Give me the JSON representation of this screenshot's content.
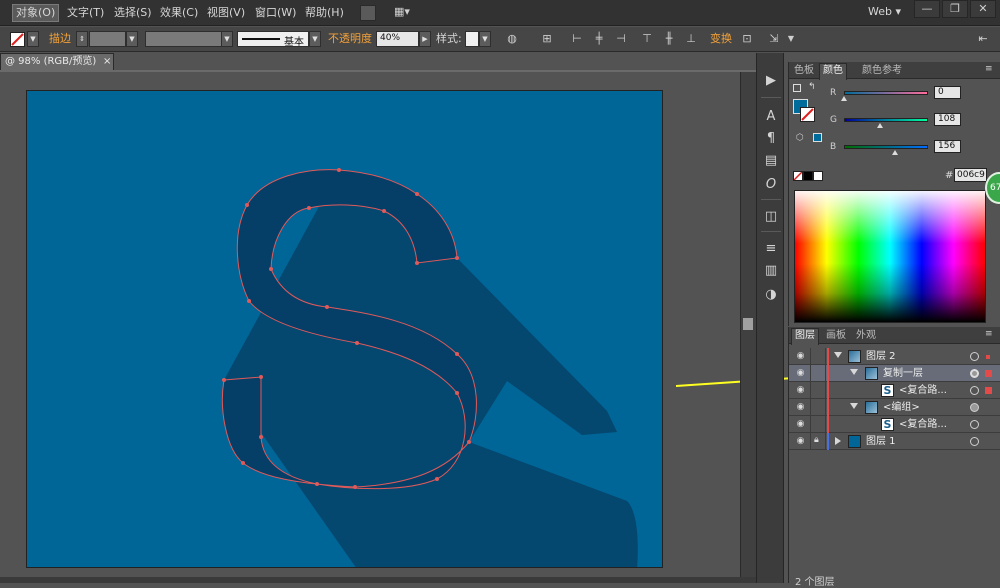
{
  "menubar": {
    "items": [
      "对象(O)",
      "文字(T)",
      "选择(S)",
      "效果(C)",
      "视图(V)",
      "窗口(W)",
      "帮助(H)"
    ],
    "active_index": 0,
    "workspace": "Web",
    "window_controls": [
      "—",
      "❐",
      "✕"
    ]
  },
  "controlbar": {
    "stroke_label": "描边",
    "brush_label": "基本",
    "opacity_label": "不透明度",
    "opacity_value": "40%",
    "style_label": "样式:",
    "transform_label": "变换"
  },
  "document_tab": {
    "title": "@ 98% (RGB/预览)",
    "close": "×"
  },
  "color_panel": {
    "tabs": [
      "色板",
      "颜色",
      "颜色参考"
    ],
    "active_tab": 1,
    "r_label": "R",
    "g_label": "G",
    "b_label": "B",
    "r_value": "0",
    "g_value": "108",
    "b_value": "156",
    "hex_label": "#",
    "hex_value": "006c9",
    "fill_color": "#006c9c"
  },
  "layers_panel": {
    "tabs": [
      "图层",
      "画板",
      "外观"
    ],
    "active_tab": 0,
    "rows": [
      {
        "name": "图层 2",
        "level": 0,
        "expanded": true,
        "selected": false
      },
      {
        "name": "复制一层",
        "level": 1,
        "expanded": true,
        "selected": true
      },
      {
        "name": "<复合路...",
        "level": 2,
        "expanded": false,
        "selected": false
      },
      {
        "name": "<编组>",
        "level": 1,
        "expanded": true,
        "selected": false
      },
      {
        "name": "<复合路...",
        "level": 2,
        "expanded": false,
        "selected": false
      },
      {
        "name": "图层 1",
        "level": 0,
        "expanded": false,
        "selected": false
      }
    ],
    "footer": "2 个图层"
  },
  "badge": {
    "text": "67"
  },
  "colors": {
    "artboard": "#006597",
    "shadow": "#04476f",
    "letter": "#053f68",
    "path": "#e05a5a",
    "arrow": "#ffff22"
  }
}
